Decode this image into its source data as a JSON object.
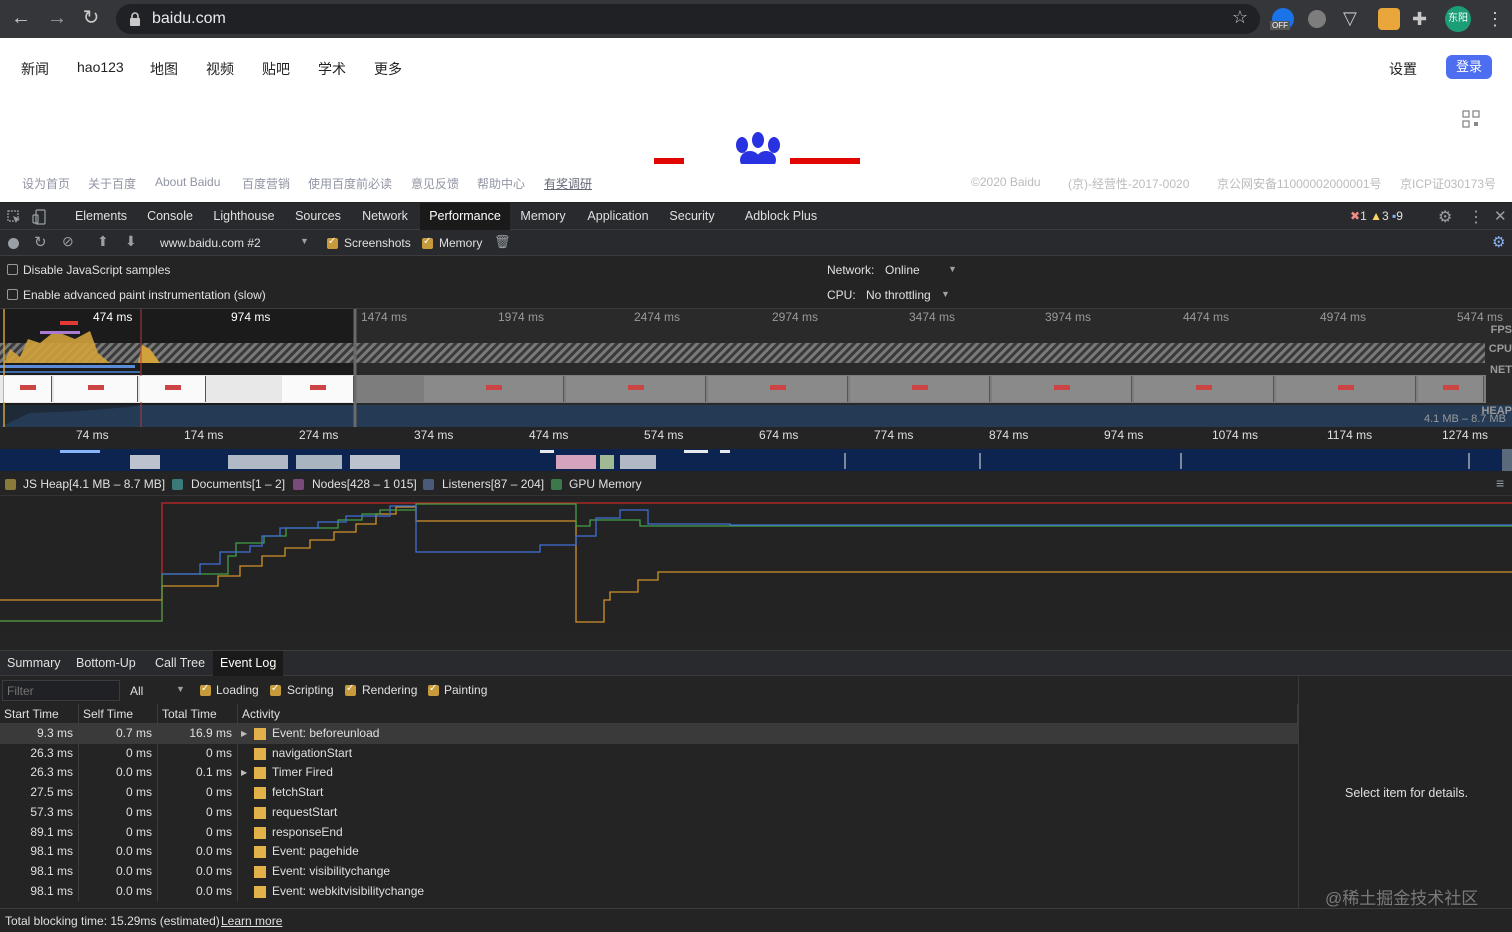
{
  "browser": {
    "url": "baidu.com",
    "ext_badge": "OFF",
    "profile_label": "东阳",
    "icons": [
      "back-arrow-icon",
      "forward-arrow-icon",
      "reload-icon",
      "lock-icon",
      "star-icon",
      "extension-icon",
      "kebab-menu-icon"
    ]
  },
  "page": {
    "nav": [
      "新闻",
      "hao123",
      "地图",
      "视频",
      "贴吧",
      "学术",
      "更多"
    ],
    "settings": "设置",
    "login": "登录",
    "footer_left": [
      "设为首页",
      "关于百度",
      "About Baidu",
      "百度营销",
      "使用百度前必读",
      "意见反馈",
      "帮助中心",
      "有奖调研"
    ],
    "footer_right": [
      "©2020 Baidu",
      "(京)-经营性-2017-0020",
      "京公网安备11000002000001号",
      "京ICP证030173号"
    ],
    "accent": "#4e6ef2"
  },
  "devtools": {
    "tabs": [
      "Elements",
      "Console",
      "Lighthouse",
      "Sources",
      "Network",
      "Performance",
      "Memory",
      "Application",
      "Security",
      "Adblock Plus"
    ],
    "active_tab": "Performance",
    "errors": "1",
    "warnings": "3",
    "messages": "9",
    "recording": "www.baidu.com #2",
    "screenshots_label": "Screenshots",
    "memory_label": "Memory",
    "disable_js": "Disable JavaScript samples",
    "advanced_paint": "Enable advanced paint instrumentation (slow)",
    "network_label": "Network:",
    "network_value": "Online",
    "cpu_label": "CPU:",
    "cpu_value": "No throttling",
    "overview_ticks": [
      "474 ms",
      "974 ms",
      "1474 ms",
      "1974 ms",
      "2474 ms",
      "2974 ms",
      "3474 ms",
      "3974 ms",
      "4474 ms",
      "4974 ms",
      "5474 ms"
    ],
    "lane_labels": [
      "FPS",
      "CPU",
      "NET",
      "HEAP"
    ],
    "heap_range": "4.1 MB – 8.7 MB",
    "detail_ticks": [
      "74 ms",
      "174 ms",
      "274 ms",
      "374 ms",
      "474 ms",
      "574 ms",
      "674 ms",
      "774 ms",
      "874 ms",
      "974 ms",
      "1074 ms",
      "1174 ms",
      "1274 ms"
    ],
    "legend": [
      {
        "label": "JS Heap[4.1 MB – 8.7 MB]",
        "color": "#8a7a3a"
      },
      {
        "label": "Documents[1 – 2]",
        "color": "#3a7a7a"
      },
      {
        "label": "Nodes[428 – 1 015]",
        "color": "#7a4a7a"
      },
      {
        "label": "Listeners[87 – 204]",
        "color": "#4a5a7a"
      },
      {
        "label": "GPU Memory",
        "color": "#3a7a4a"
      }
    ],
    "bottom_tabs": [
      "Summary",
      "Bottom-Up",
      "Call Tree",
      "Event Log"
    ],
    "active_bottom_tab": "Event Log",
    "filter_placeholder": "Filter",
    "filter_all": "All",
    "categories": [
      "Loading",
      "Scripting",
      "Rendering",
      "Painting"
    ],
    "columns": [
      "Start Time",
      "Self Time",
      "Total Time",
      "Activity"
    ],
    "rows": [
      {
        "start": "9.3 ms",
        "self": "0.7 ms",
        "total": "16.9 ms",
        "activity": "Event: beforeunload",
        "expand": true
      },
      {
        "start": "26.3 ms",
        "self": "0 ms",
        "total": "0 ms",
        "activity": "navigationStart",
        "expand": false
      },
      {
        "start": "26.3 ms",
        "self": "0.0 ms",
        "total": "0.1 ms",
        "activity": "Timer Fired",
        "expand": true
      },
      {
        "start": "27.5 ms",
        "self": "0 ms",
        "total": "0 ms",
        "activity": "fetchStart",
        "expand": false
      },
      {
        "start": "57.3 ms",
        "self": "0 ms",
        "total": "0 ms",
        "activity": "requestStart",
        "expand": false
      },
      {
        "start": "89.1 ms",
        "self": "0 ms",
        "total": "0 ms",
        "activity": "responseEnd",
        "expand": false
      },
      {
        "start": "98.1 ms",
        "self": "0.0 ms",
        "total": "0.0 ms",
        "activity": "Event: pagehide",
        "expand": false
      },
      {
        "start": "98.1 ms",
        "self": "0.0 ms",
        "total": "0.0 ms",
        "activity": "Event: visibilitychange",
        "expand": false
      },
      {
        "start": "98.1 ms",
        "self": "0.0 ms",
        "total": "0.0 ms",
        "activity": "Event: webkitvisibilitychange",
        "expand": false
      }
    ],
    "details": "Select item for details.",
    "status_text": "Total blocking time: 15.29ms (estimated)",
    "learn_more": "Learn more",
    "watermark": "@稀土掘金技术社区"
  }
}
